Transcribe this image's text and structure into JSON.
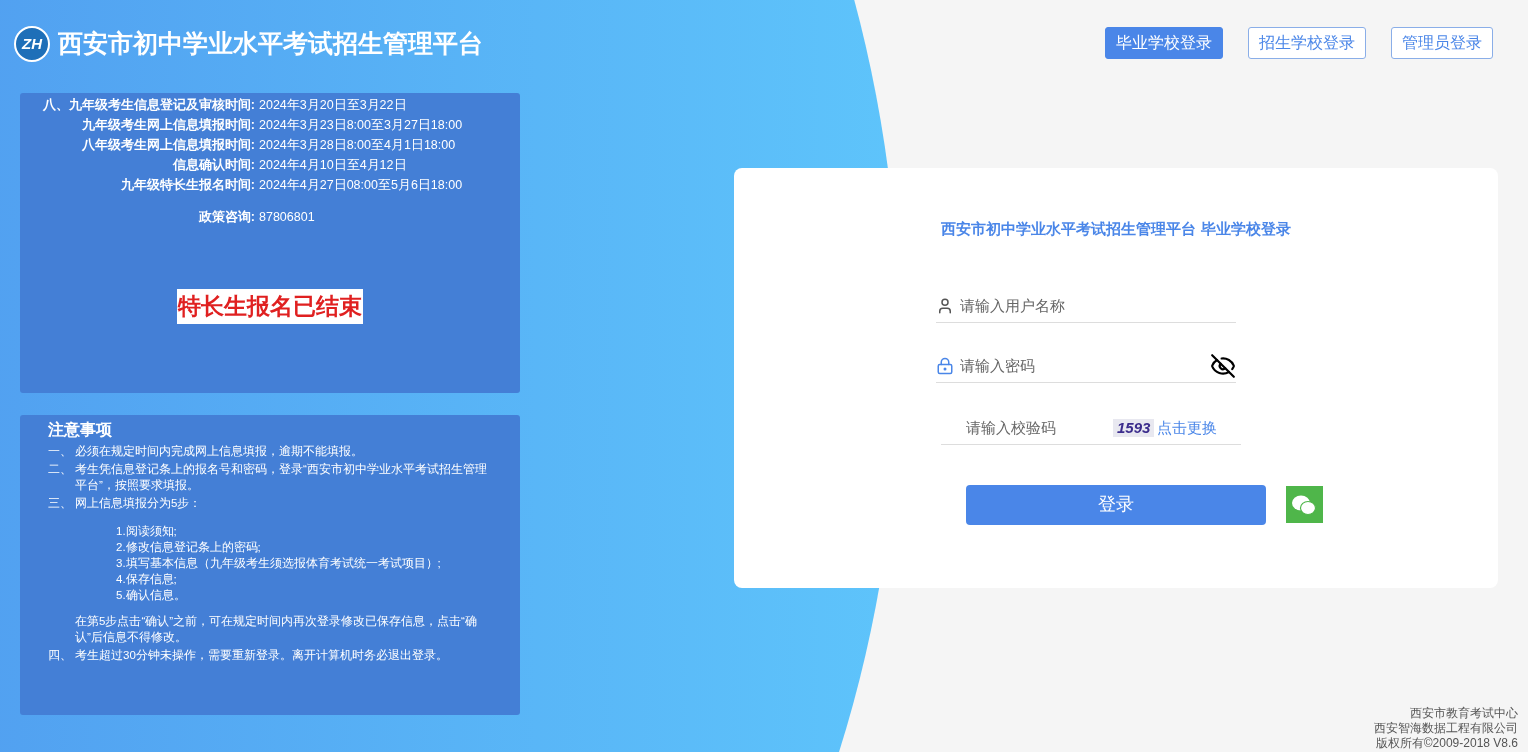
{
  "header": {
    "logo_text": "ZH",
    "title": "西安市初中学业水平考试招生管理平台"
  },
  "login_tabs": [
    {
      "label": "毕业学校登录",
      "selected": true
    },
    {
      "label": "招生学校登录",
      "selected": false
    },
    {
      "label": "管理员登录",
      "selected": false
    }
  ],
  "schedule": {
    "rows": [
      {
        "label": "八、九年级考生信息登记及审核时间:",
        "value": "2024年3月20日至3月22日"
      },
      {
        "label": "九年级考生网上信息填报时间:",
        "value": "2024年3月23日8:00至3月27日18:00"
      },
      {
        "label": "八年级考生网上信息填报时间:",
        "value": "2024年3月28日8:00至4月1日18:00"
      },
      {
        "label": "信息确认时间:",
        "value": "2024年4月10日至4月12日"
      },
      {
        "label": "九年级特长生报名时间:",
        "value": "2024年4月27日08:00至5月6日18:00"
      }
    ],
    "consult": {
      "label": "政策咨询:",
      "value": "87806801"
    },
    "notice": "特长生报名已结束"
  },
  "notes": {
    "title": "注意事项",
    "items": [
      {
        "marker": "一、",
        "text": "必须在规定时间内完成网上信息填报，逾期不能填报。"
      },
      {
        "marker": "二、",
        "text": "考生凭信息登记条上的报名号和密码，登录“西安市初中学业水平考试招生管理平台”，按照要求填报。"
      },
      {
        "marker": "三、",
        "text": "网上信息填报分为5步：",
        "steps": [
          "1.阅读须知;",
          "2.修改信息登记条上的密码;",
          "3.填写基本信息（九年级考生须选报体育考试统一考试项目）;",
          "4.保存信息;",
          "5.确认信息。"
        ],
        "after": "在第5步点击“确认”之前，可在规定时间内再次登录修改已保存信息，点击“确认”后信息不得修改。"
      },
      {
        "marker": "四、",
        "text": "考生超过30分钟未操作，需要重新登录。离开计算机时务必退出登录。"
      }
    ]
  },
  "login": {
    "title": "西安市初中学业水平考试招生管理平台 毕业学校登录",
    "username": {
      "placeholder": "请输入用户名称"
    },
    "password": {
      "placeholder": "请输入密码"
    },
    "captcha": {
      "placeholder": "请输入校验码",
      "code": "1593",
      "refresh": "点击更换"
    },
    "submit": "登录"
  },
  "footer": [
    "西安市教育考试中心",
    "西安智海数据工程有限公司",
    "版权所有©2009-2018 V8.6"
  ]
}
